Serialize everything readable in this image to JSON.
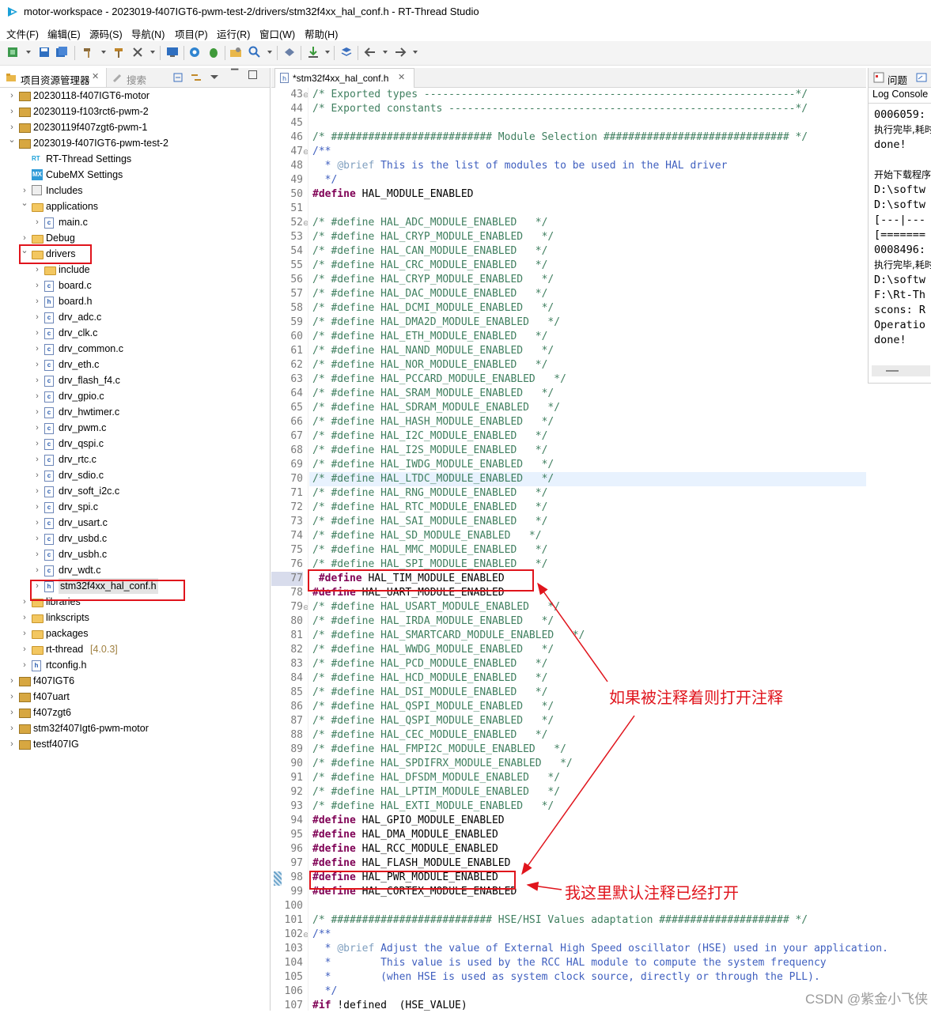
{
  "title_bar": {
    "text": "motor-workspace - 2023019-f407IGT6-pwm-test-2/drivers/stm32f4xx_hal_conf.h - RT-Thread Studio"
  },
  "menu": [
    "文件(F)",
    "编辑(E)",
    "源码(S)",
    "导航(N)",
    "项目(P)",
    "运行(R)",
    "窗口(W)",
    "帮助(H)"
  ],
  "left_panel": {
    "tab_active": "项目资源管理器",
    "tab_inactive": "搜索",
    "tree": [
      {
        "label": "20230118-f407IGT6-motor",
        "depth": 0,
        "kind": "project",
        "expanded": false
      },
      {
        "label": "20230119-f103rct6-pwm-2",
        "depth": 0,
        "kind": "project",
        "expanded": false
      },
      {
        "label": "20230119f407zgt6-pwm-1",
        "depth": 0,
        "kind": "project",
        "expanded": false
      },
      {
        "label": "2023019-f407IGT6-pwm-test-2",
        "depth": 0,
        "kind": "project",
        "expanded": true
      },
      {
        "label": "RT-Thread Settings",
        "depth": 1,
        "kind": "rt",
        "expanded": null
      },
      {
        "label": "CubeMX Settings",
        "depth": 1,
        "kind": "mx",
        "expanded": null
      },
      {
        "label": "Includes",
        "depth": 1,
        "kind": "includes",
        "expanded": false
      },
      {
        "label": "applications",
        "depth": 1,
        "kind": "folder",
        "expanded": true
      },
      {
        "label": "main.c",
        "depth": 2,
        "kind": "c",
        "expanded": false
      },
      {
        "label": "Debug",
        "depth": 1,
        "kind": "folder",
        "expanded": false
      },
      {
        "label": "drivers",
        "depth": 1,
        "kind": "folder",
        "expanded": true
      },
      {
        "label": "include",
        "depth": 2,
        "kind": "folder",
        "expanded": false
      },
      {
        "label": "board.c",
        "depth": 2,
        "kind": "c",
        "expanded": false
      },
      {
        "label": "board.h",
        "depth": 2,
        "kind": "h",
        "expanded": false
      },
      {
        "label": "drv_adc.c",
        "depth": 2,
        "kind": "c",
        "expanded": false
      },
      {
        "label": "drv_clk.c",
        "depth": 2,
        "kind": "c",
        "expanded": false
      },
      {
        "label": "drv_common.c",
        "depth": 2,
        "kind": "c",
        "expanded": false
      },
      {
        "label": "drv_eth.c",
        "depth": 2,
        "kind": "c",
        "expanded": false
      },
      {
        "label": "drv_flash_f4.c",
        "depth": 2,
        "kind": "c",
        "expanded": false
      },
      {
        "label": "drv_gpio.c",
        "depth": 2,
        "kind": "c",
        "expanded": false
      },
      {
        "label": "drv_hwtimer.c",
        "depth": 2,
        "kind": "c",
        "expanded": false
      },
      {
        "label": "drv_pwm.c",
        "depth": 2,
        "kind": "c",
        "expanded": false
      },
      {
        "label": "drv_qspi.c",
        "depth": 2,
        "kind": "c",
        "expanded": false
      },
      {
        "label": "drv_rtc.c",
        "depth": 2,
        "kind": "c",
        "expanded": false
      },
      {
        "label": "drv_sdio.c",
        "depth": 2,
        "kind": "c",
        "expanded": false
      },
      {
        "label": "drv_soft_i2c.c",
        "depth": 2,
        "kind": "c",
        "expanded": false
      },
      {
        "label": "drv_spi.c",
        "depth": 2,
        "kind": "c",
        "expanded": false
      },
      {
        "label": "drv_usart.c",
        "depth": 2,
        "kind": "c",
        "expanded": false
      },
      {
        "label": "drv_usbd.c",
        "depth": 2,
        "kind": "c",
        "expanded": false
      },
      {
        "label": "drv_usbh.c",
        "depth": 2,
        "kind": "c",
        "expanded": false
      },
      {
        "label": "drv_wdt.c",
        "depth": 2,
        "kind": "c",
        "expanded": false
      },
      {
        "label": "stm32f4xx_hal_conf.h",
        "depth": 2,
        "kind": "h",
        "expanded": false,
        "selected": true
      },
      {
        "label": "libraries",
        "depth": 1,
        "kind": "folder",
        "expanded": false
      },
      {
        "label": "linkscripts",
        "depth": 1,
        "kind": "folder",
        "expanded": false
      },
      {
        "label": "packages",
        "depth": 1,
        "kind": "folder",
        "expanded": false
      },
      {
        "label": "rt-thread",
        "suffix": "[4.0.3]",
        "depth": 1,
        "kind": "folder",
        "expanded": false
      },
      {
        "label": "rtconfig.h",
        "depth": 1,
        "kind": "h",
        "expanded": false
      },
      {
        "label": "f407IGT6",
        "depth": 0,
        "kind": "project",
        "expanded": false
      },
      {
        "label": "f407uart",
        "depth": 0,
        "kind": "project",
        "expanded": false
      },
      {
        "label": "f407zgt6",
        "depth": 0,
        "kind": "project",
        "expanded": false
      },
      {
        "label": "stm32f407Igt6-pwm-motor",
        "depth": 0,
        "kind": "project",
        "expanded": false
      },
      {
        "label": "testf407IG",
        "depth": 0,
        "kind": "project",
        "expanded": false
      }
    ]
  },
  "editor": {
    "tab_label": "*stm32f4xx_hal_conf.h",
    "current_line": 70,
    "lines": [
      {
        "n": 43,
        "fold": true,
        "t": "/* Exported types ------------------------------------------------------------*/"
      },
      {
        "n": 44,
        "t": "/* Exported constants --------------------------------------------------------*/"
      },
      {
        "n": 45,
        "t": ""
      },
      {
        "n": 46,
        "t": "/* ########################## Module Selection ############################## */"
      },
      {
        "n": 47,
        "fold": true,
        "t": "/**"
      },
      {
        "n": 48,
        "t": "  * @brief This is the list of modules to be used in the HAL driver"
      },
      {
        "n": 49,
        "t": "  */"
      },
      {
        "n": 50,
        "t": "#define HAL_MODULE_ENABLED"
      },
      {
        "n": 51,
        "t": ""
      },
      {
        "n": 52,
        "fold": true,
        "t": "/* #define HAL_ADC_MODULE_ENABLED   */"
      },
      {
        "n": 53,
        "t": "/* #define HAL_CRYP_MODULE_ENABLED   */"
      },
      {
        "n": 54,
        "t": "/* #define HAL_CAN_MODULE_ENABLED   */"
      },
      {
        "n": 55,
        "t": "/* #define HAL_CRC_MODULE_ENABLED   */"
      },
      {
        "n": 56,
        "t": "/* #define HAL_CRYP_MODULE_ENABLED   */"
      },
      {
        "n": 57,
        "t": "/* #define HAL_DAC_MODULE_ENABLED   */"
      },
      {
        "n": 58,
        "t": "/* #define HAL_DCMI_MODULE_ENABLED   */"
      },
      {
        "n": 59,
        "t": "/* #define HAL_DMA2D_MODULE_ENABLED   */"
      },
      {
        "n": 60,
        "t": "/* #define HAL_ETH_MODULE_ENABLED   */"
      },
      {
        "n": 61,
        "t": "/* #define HAL_NAND_MODULE_ENABLED   */"
      },
      {
        "n": 62,
        "t": "/* #define HAL_NOR_MODULE_ENABLED   */"
      },
      {
        "n": 63,
        "t": "/* #define HAL_PCCARD_MODULE_ENABLED   */"
      },
      {
        "n": 64,
        "t": "/* #define HAL_SRAM_MODULE_ENABLED   */"
      },
      {
        "n": 65,
        "t": "/* #define HAL_SDRAM_MODULE_ENABLED   */"
      },
      {
        "n": 66,
        "t": "/* #define HAL_HASH_MODULE_ENABLED   */"
      },
      {
        "n": 67,
        "t": "/* #define HAL_I2C_MODULE_ENABLED   */"
      },
      {
        "n": 68,
        "t": "/* #define HAL_I2S_MODULE_ENABLED   */"
      },
      {
        "n": 69,
        "t": "/* #define HAL_IWDG_MODULE_ENABLED   */"
      },
      {
        "n": 70,
        "t": "/* #define HAL_LTDC_MODULE_ENABLED   */"
      },
      {
        "n": 71,
        "t": "/* #define HAL_RNG_MODULE_ENABLED   */"
      },
      {
        "n": 72,
        "t": "/* #define HAL_RTC_MODULE_ENABLED   */"
      },
      {
        "n": 73,
        "t": "/* #define HAL_SAI_MODULE_ENABLED   */"
      },
      {
        "n": 74,
        "t": "/* #define HAL_SD_MODULE_ENABLED   */"
      },
      {
        "n": 75,
        "t": "/* #define HAL_MMC_MODULE_ENABLED   */"
      },
      {
        "n": 76,
        "t": "/* #define HAL_SPI_MODULE_ENABLED   */"
      },
      {
        "n": 77,
        "t": " #define HAL_TIM_MODULE_ENABLED"
      },
      {
        "n": 78,
        "t": "#define HAL_UART_MODULE_ENABLED"
      },
      {
        "n": 79,
        "fold": true,
        "t": "/* #define HAL_USART_MODULE_ENABLED   */"
      },
      {
        "n": 80,
        "t": "/* #define HAL_IRDA_MODULE_ENABLED   */"
      },
      {
        "n": 81,
        "t": "/* #define HAL_SMARTCARD_MODULE_ENABLED   */"
      },
      {
        "n": 82,
        "t": "/* #define HAL_WWDG_MODULE_ENABLED   */"
      },
      {
        "n": 83,
        "t": "/* #define HAL_PCD_MODULE_ENABLED   */"
      },
      {
        "n": 84,
        "t": "/* #define HAL_HCD_MODULE_ENABLED   */"
      },
      {
        "n": 85,
        "t": "/* #define HAL_DSI_MODULE_ENABLED   */"
      },
      {
        "n": 86,
        "t": "/* #define HAL_QSPI_MODULE_ENABLED   */"
      },
      {
        "n": 87,
        "t": "/* #define HAL_QSPI_MODULE_ENABLED   */"
      },
      {
        "n": 88,
        "t": "/* #define HAL_CEC_MODULE_ENABLED   */"
      },
      {
        "n": 89,
        "t": "/* #define HAL_FMPI2C_MODULE_ENABLED   */"
      },
      {
        "n": 90,
        "t": "/* #define HAL_SPDIFRX_MODULE_ENABLED   */"
      },
      {
        "n": 91,
        "t": "/* #define HAL_DFSDM_MODULE_ENABLED   */"
      },
      {
        "n": 92,
        "t": "/* #define HAL_LPTIM_MODULE_ENABLED   */"
      },
      {
        "n": 93,
        "t": "/* #define HAL_EXTI_MODULE_ENABLED   */"
      },
      {
        "n": 94,
        "t": "#define HAL_GPIO_MODULE_ENABLED"
      },
      {
        "n": 95,
        "t": "#define HAL_DMA_MODULE_ENABLED"
      },
      {
        "n": 96,
        "t": "#define HAL_RCC_MODULE_ENABLED"
      },
      {
        "n": 97,
        "t": "#define HAL_FLASH_MODULE_ENABLED"
      },
      {
        "n": 98,
        "t": "#define HAL_PWR_MODULE_ENABLED"
      },
      {
        "n": 99,
        "t": "#define HAL_CORTEX_MODULE_ENABLED"
      },
      {
        "n": 100,
        "t": ""
      },
      {
        "n": 101,
        "t": "/* ########################## HSE/HSI Values adaptation ##################### */"
      },
      {
        "n": 102,
        "fold": true,
        "t": "/**"
      },
      {
        "n": 103,
        "t": "  * @brief Adjust the value of External High Speed oscillator (HSE) used in your application."
      },
      {
        "n": 104,
        "t": "  *        This value is used by the RCC HAL module to compute the system frequency"
      },
      {
        "n": 105,
        "t": "  *        (when HSE is used as system clock source, directly or through the PLL)."
      },
      {
        "n": 106,
        "t": "  */"
      },
      {
        "n": 107,
        "t": "#if !defined  (HSE_VALUE)"
      }
    ]
  },
  "right_panel": {
    "tab_problems": "问题",
    "console_label": "Log Console",
    "lines": [
      "0006059:",
      "执行完毕,耗时",
      "done!",
      "",
      "开始下载程序",
      "D:\\softw",
      "D:\\softw",
      "[---|---",
      "[=======",
      "0008496:",
      "执行完毕,耗时",
      "D:\\softw",
      "F:\\Rt-Th",
      "scons: R",
      "Operatio",
      "done!"
    ]
  },
  "annotations": {
    "note_top": "如果被注释着则打开注释",
    "note_bottom": "我这里默认注释已经打开",
    "watermark": "CSDN @紫金小飞侠"
  },
  "colors": {
    "annotation_red": "#e0141c",
    "comment": "#3f7f5f",
    "keyword": "#7f0055",
    "doc": "#3f5fbf"
  }
}
